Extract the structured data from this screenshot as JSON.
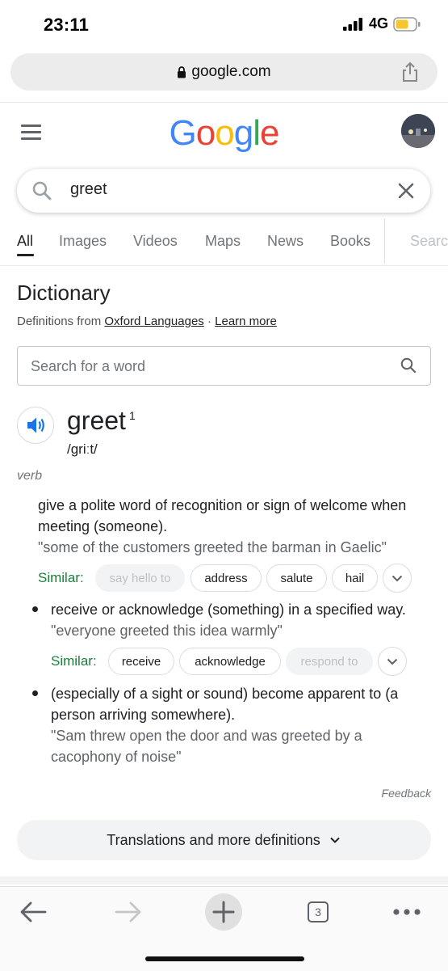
{
  "status_bar": {
    "time": "23:11",
    "network": "4G"
  },
  "url_bar": {
    "domain": "google.com"
  },
  "search": {
    "query": "greet"
  },
  "tabs": [
    "All",
    "Images",
    "Videos",
    "Maps",
    "News",
    "Books",
    "Searc"
  ],
  "dictionary": {
    "title": "Dictionary",
    "source_prefix": "Definitions from ",
    "source_link": "Oxford Languages",
    "separator": " · ",
    "learn_more": "Learn more",
    "search_placeholder": "Search for a word",
    "word": "greet",
    "superscript": "1",
    "phonetic": "/ɡriːt/",
    "part_of_speech": "verb",
    "definitions": [
      {
        "text_line1": "give a polite word of recognition or sign of welcome when",
        "text_line2": "meeting (someone).",
        "example": "\"some of the customers greeted the barman in Gaelic\"",
        "similar_label": "Similar:",
        "similar": [
          "say hello to",
          "address",
          "salute",
          "hail"
        ]
      },
      {
        "text_line1": "receive or acknowledge (something) in a specified way.",
        "example": "\"everyone greeted this idea warmly\"",
        "similar_label": "Similar:",
        "similar": [
          "receive",
          "acknowledge",
          "respond to"
        ]
      },
      {
        "text_line1": "(especially of a sight or sound) become apparent to (a",
        "text_line2": "person arriving somewhere).",
        "example_line1": "\"Sam threw open the door and was greeted by a",
        "example_line2": "cacophony of noise\""
      }
    ],
    "feedback": "Feedback",
    "more_button": "Translations and more definitions"
  },
  "toolbar": {
    "tab_count": "3"
  },
  "colors": {
    "google_blue": "#4285F4",
    "google_red": "#EA4335",
    "google_yellow": "#FBBC05",
    "google_green": "#34A853",
    "similar_green": "#188038"
  },
  "icons": [
    "lock-icon",
    "share-icon",
    "hamburger-icon",
    "search-icon",
    "clear-icon",
    "speaker-icon",
    "chevron-down-icon",
    "back-icon",
    "forward-icon",
    "plus-icon",
    "tabs-icon",
    "more-icon"
  ]
}
